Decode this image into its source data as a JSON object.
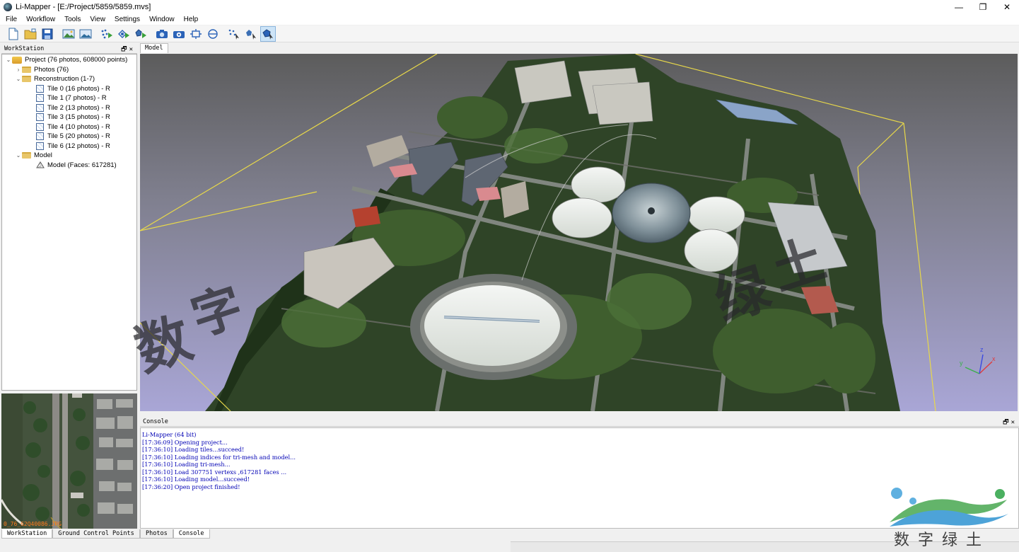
{
  "window": {
    "title": "Li-Mapper - [E:/Project/5859/5859.mvs]",
    "controls": [
      "—",
      "❐",
      "✕"
    ]
  },
  "menu": [
    "File",
    "Workflow",
    "Tools",
    "View",
    "Settings",
    "Window",
    "Help"
  ],
  "toolbar": {
    "icons": [
      "new-project-icon",
      "open-project-icon",
      "save-icon",
      "import-images-icon",
      "image-list-icon",
      "align-photos-icon",
      "dense-cloud-icon",
      "build-mesh-icon",
      "camera-view-icon",
      "camera-settings-icon",
      "fit-view-icon",
      "rotate-view-icon",
      "point-select-icon",
      "point-edit-icon",
      "texture-mesh-icon"
    ],
    "active_index": 14
  },
  "workstation": {
    "header": "WorkStation",
    "controls": "🗗✕",
    "tree": {
      "project": "Project (76 photos, 608000 points)",
      "photos": "Photos (76)",
      "reconstruction": "Reconstruction (1-7)",
      "tiles": [
        "Tile 0 (16 photos) - R",
        "Tile 1 (7 photos) - R",
        "Tile 2 (13 photos) - R",
        "Tile 3 (15 photos) - R",
        "Tile 4 (10 photos) - R",
        "Tile 5 (20 photos) - R",
        "Tile 6 (12 photos) - R"
      ],
      "model_folder": "Model",
      "model_item": "Model (Faces: 617281)"
    }
  },
  "preview": {
    "label": "0_76_62Q40086.JPG"
  },
  "left_tabs": [
    "WorkStation",
    "Ground Control Points"
  ],
  "viewport": {
    "tab": "Model",
    "axes": {
      "x": "x",
      "y": "y",
      "z": "z"
    }
  },
  "console": {
    "header": "Console",
    "controls": "🗗✕",
    "lines": [
      "Li-Mapper (64 bit)",
      "[17:36:09] Opening project...",
      "[17:36:10] Loading tiles...succeed!",
      "[17:36:10] Loading indices for tri-mesh and model...",
      "[17:36:10] Loading tri-mesh...",
      "[17:36:10] Load 307751 vertexs ,617281 faces ...",
      "[17:36:10] Loading model...succeed!",
      "[17:36:20] Open project finished!"
    ]
  },
  "bottom_tabs": [
    "Photos",
    "Console"
  ],
  "watermark": {
    "chars": [
      "数",
      "字",
      "绿",
      "土"
    ],
    "brand": "数字绿土"
  },
  "colors": {
    "console_text": "#0000b4",
    "bbox_line": "#e8d84a",
    "preview_label": "#ff7a1a"
  }
}
